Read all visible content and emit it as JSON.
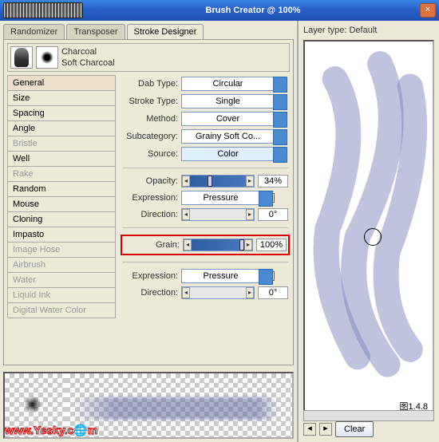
{
  "window": {
    "title": "Brush Creator @ 100%"
  },
  "tabs": {
    "t0": "Randomizer",
    "t1": "Transposer",
    "t2": "Stroke Designer"
  },
  "brush": {
    "name": "Charcoal",
    "variant": "Soft Charcoal"
  },
  "categories": [
    {
      "label": "General",
      "sel": true
    },
    {
      "label": "Size"
    },
    {
      "label": "Spacing"
    },
    {
      "label": "Angle"
    },
    {
      "label": "Bristle",
      "disabled": true
    },
    {
      "label": "Well"
    },
    {
      "label": "Rake",
      "disabled": true
    },
    {
      "label": "Random"
    },
    {
      "label": "Mouse"
    },
    {
      "label": "Cloning"
    },
    {
      "label": "Impasto"
    },
    {
      "label": "Image Hose",
      "disabled": true
    },
    {
      "label": "Airbrush",
      "disabled": true
    },
    {
      "label": "Water",
      "disabled": true
    },
    {
      "label": "Liquid Ink",
      "disabled": true
    },
    {
      "label": "Digital Water Color",
      "disabled": true
    }
  ],
  "props": {
    "dab_label": "Dab Type:",
    "dab_val": "Circular",
    "stroke_label": "Stroke Type:",
    "stroke_val": "Single",
    "method_label": "Method:",
    "method_val": "Cover",
    "subcat_label": "Subcategory:",
    "subcat_val": "Grainy Soft Co...",
    "source_label": "Source:",
    "source_val": "Color",
    "opacity_label": "Opacity:",
    "opacity_val": "34%",
    "expr1_label": "Expression:",
    "expr1_val": "Pressure",
    "dir1_label": "Direction:",
    "dir1_val": "0°",
    "grain_label": "Grain:",
    "grain_val": "100%",
    "expr2_label": "Expression:",
    "expr2_val": "Pressure",
    "dir2_label": "Direction:",
    "dir2_val": "0°"
  },
  "right": {
    "layertype_label": "Layer type: Default",
    "corner": "图1.4.8",
    "clear": "Clear"
  },
  "watermark": "www.Yesky.c🌐m"
}
